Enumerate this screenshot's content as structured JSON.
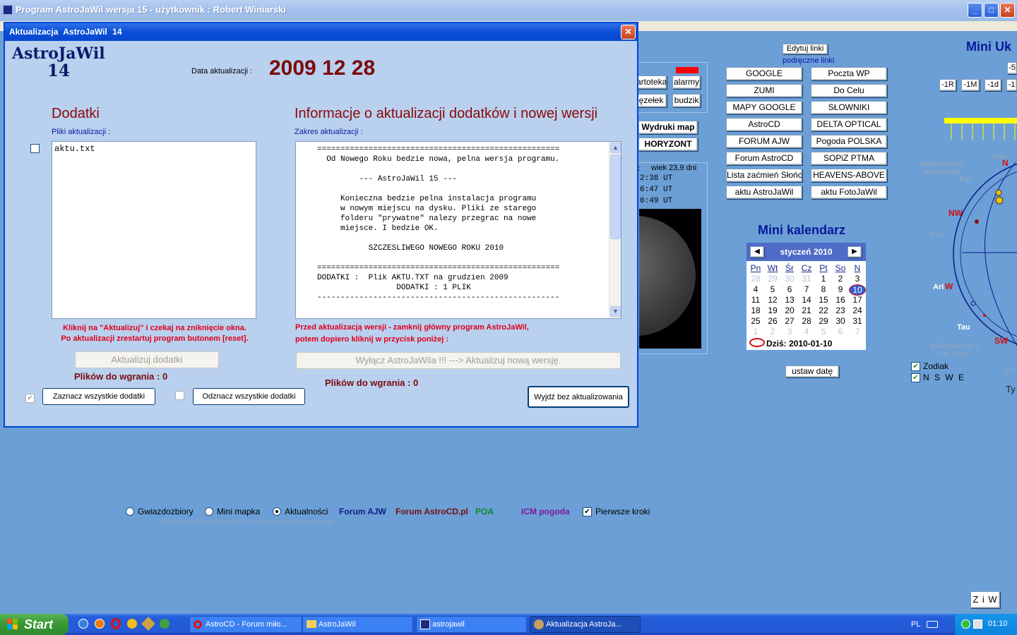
{
  "window": {
    "title": "Program AstroJaWil wersja 15 - użytkownik : Robert Winiarski"
  },
  "bg_panel": {
    "left_col_buttons": [
      "artoteka",
      "alarmy",
      "ęzełek",
      "budzik"
    ],
    "wydruki_label": "Wydruki map",
    "horyzont_label": "HORYZONT",
    "moon_age": "wiek 23,9 dni",
    "moon_times": [
      "2:38 UT",
      "6:47 UT",
      "0:49 UT"
    ],
    "links_edit": "Edytuj linki",
    "links_caption": "podręczne linki",
    "links_left": [
      "GOOGLE",
      "ZUMI",
      "MAPY GOOGLE",
      "AstroCD",
      "FORUM AJW",
      "Forum AstroCD",
      "Lista zaćmień Słońca",
      "aktu  AstroJaWil"
    ],
    "links_right": [
      "Poczta WP",
      "Do Celu",
      "SŁOWNIKI",
      "DELTA OPTICAL",
      "Pogoda POLSKA",
      "SOPiZ PTMA",
      "HEAVENS-ABOVE",
      "aktu  FotoJaWil"
    ],
    "calendar": {
      "title": "Mini kalendarz",
      "month": "styczeń 2010",
      "prev": "◀",
      "next": "▶",
      "days": [
        "Pn",
        "Wt",
        "Śr",
        "Cz",
        "Pt",
        "So",
        "N"
      ],
      "weeks": [
        [
          "28",
          "29",
          "30",
          "31",
          "1",
          "2",
          "3"
        ],
        [
          "4",
          "5",
          "6",
          "7",
          "8",
          "9",
          "10"
        ],
        [
          "11",
          "12",
          "13",
          "14",
          "15",
          "16",
          "17"
        ],
        [
          "18",
          "19",
          "20",
          "21",
          "22",
          "23",
          "24"
        ],
        [
          "25",
          "26",
          "27",
          "28",
          "29",
          "30",
          "31"
        ],
        [
          "1",
          "2",
          "3",
          "4",
          "5",
          "6",
          "7"
        ]
      ],
      "today_label": "Dziś: 2010-01-10",
      "set_date": "ustaw datę"
    },
    "mini_uk": "Mini Uk",
    "step_buttons": [
      "-1R",
      "-1M",
      "-1d",
      "-1"
    ],
    "top_right_btn": "-5",
    "sky_labels": {
      "vis_evening": "widoczność wieczorna",
      "vis_night": "widoczność I cz. nocy",
      "wid": "wid",
      "ty": "Ty",
      "n": "N",
      "nw": "NW",
      "w": "W",
      "sw": "SW",
      "can": "Can",
      "aqr": "Aqr",
      "psc": "Psc",
      "ari": "Ari",
      "tau": "Tau"
    },
    "zodiak_label": "Zodiak",
    "nswe_label": "N S W E",
    "bottom_radios": [
      "Gwiazdozbiory",
      "Mini mapka",
      "Aktualności"
    ],
    "bottom_links": [
      "Forum AJW",
      "Forum AstroCD.pl",
      "POA",
      "ICM pogoda"
    ],
    "first_steps": "Pierwsze kroki",
    "hint": "Kliknij na niebieski panel - zobaczysz drugą stronę",
    "ziw": "Z i W"
  },
  "dialog": {
    "title": "Aktualizacja   AstroJaWil 14",
    "logo_name": "AstroJaWil",
    "logo_version": "14",
    "date_label": "Data  aktualizacji  :",
    "date_value": "2009 12 28",
    "addons_title": "Dodatki",
    "addons_files_label": "Pliki aktualizacji :",
    "addons_file": "aktu.txt",
    "addons_note1": "Kliknij na \"Aktualizuj\" i czekaj na zniknięcie okna.",
    "addons_note2": "Po aktualizacji zrestartuj program butonem [reset].",
    "update_addons_btn": "Aktualizuj  dodatki",
    "files_to_load": "Plików do wgrania :  0",
    "select_all_btn": "Zaznacz wszystkie dodatki",
    "deselect_all_btn": "Odznacz wszystkie dodatki",
    "info_title": "Informacje o aktualizacji dodatków i nowej wersji",
    "scope_label": "Zakres aktualizacji  :",
    "info_lines": [
      "====================================================",
      "  Od Nowego Roku bedzie nowa, pelna wersja programu.",
      "",
      "         --- AstroJaWil 15 ---",
      "",
      "     Konieczna bedzie pelna instalacja programu",
      "     w nowym miejscu na dysku. Pliki ze starego",
      "     folderu \"prywatne\" nalezy przegrac na nowe",
      "     miejsce. I bedzie OK.",
      "",
      "           SZCZESLIWEGO NOWEGO ROKU 2010",
      "",
      "====================================================",
      "DODATKI :  Plik AKTU.TXT na grudzien 2009",
      "                 DODATKI : 1 PLIK",
      "----------------------------------------------------"
    ],
    "version_note1": "Przed aktualizacją wersji - zamknij główny program AstroJaWil,",
    "version_note2": "potem dopiero kliknij w przycisk poniżej :",
    "update_version_btn": "Wyłącz AstroJaWila !!!   --->   Aktualizuj nową wersję.",
    "files_to_load2": "Plików do wgrania :  0",
    "exit_btn": "Wyjdź bez aktualizowania"
  },
  "taskbar": {
    "start": "Start",
    "tasks": [
      "AstroCD - Forum miło...",
      "AstroJaWil",
      "astrojawil",
      "Aktualizacja   AstroJa..."
    ],
    "lang": "PL",
    "clock": "01:10"
  }
}
